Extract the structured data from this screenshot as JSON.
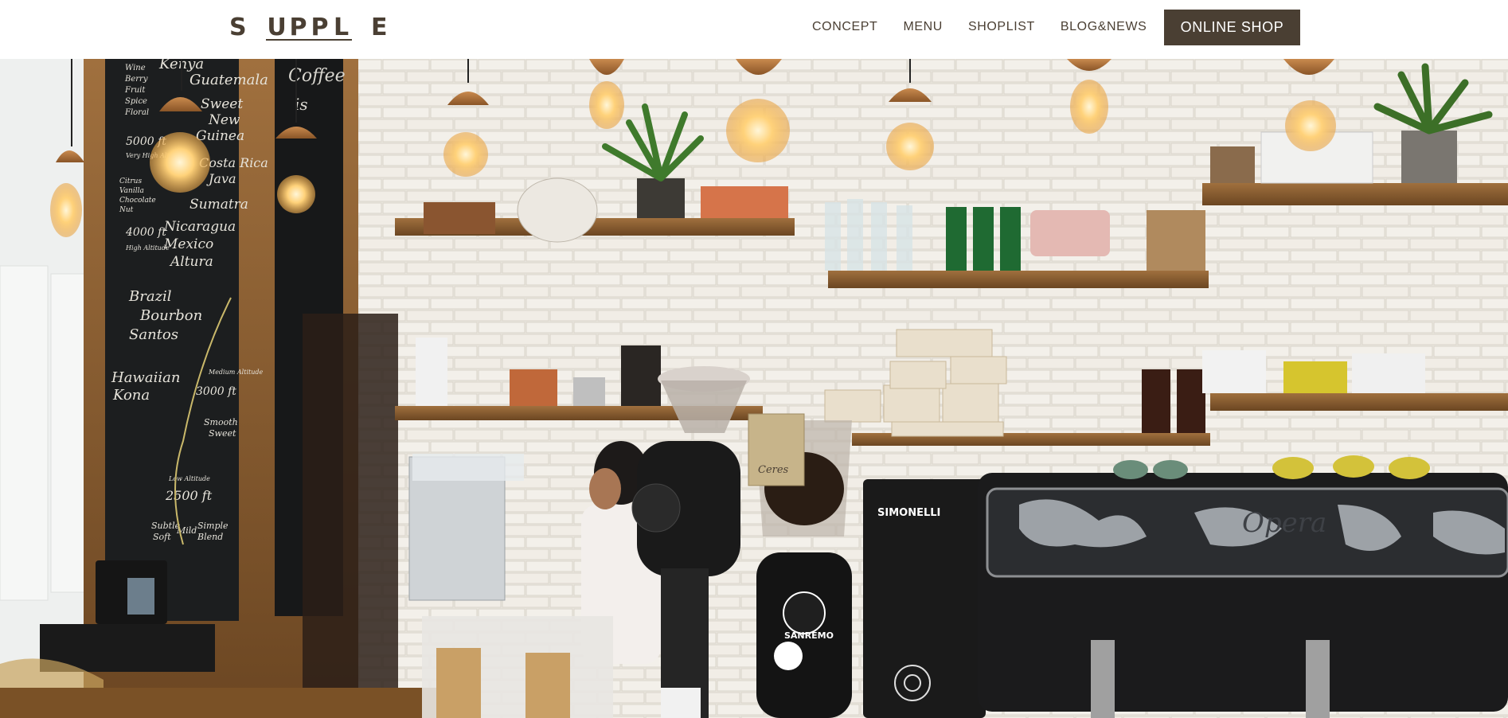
{
  "brand": {
    "first": "S",
    "middle": [
      "U",
      "P",
      "P",
      "L"
    ],
    "last": "E",
    "color": "#4a3f33"
  },
  "nav": {
    "links": [
      "CONCEPT",
      "MENU",
      "SHOPLIST",
      "BLOG&NEWS"
    ],
    "cta": "ONLINE SHOP"
  },
  "hero": {
    "menu_board": {
      "top": [
        "Kenya",
        "Guatemala"
      ],
      "left_col": [
        "Wine",
        "Berry",
        "Fruit",
        "Spice",
        "Floral"
      ],
      "lines": [
        "Sweet",
        "New",
        "Guinea",
        "Costa Rica",
        "Java",
        "Sumatra",
        "Nicaragua",
        "Mexico",
        "Altura",
        "Brazil",
        "Bourbon",
        "Santos",
        "Hawaiian",
        "Kona"
      ],
      "altitudes": [
        "5000 ft",
        "Very High Altitude",
        "4000 ft",
        "High Altitude",
        "3000 ft",
        "Medium Altitude",
        "2500 ft",
        "Low Altitude"
      ],
      "notes": [
        "Citrus",
        "Vanilla",
        "Chocolate",
        "Nut",
        "Smooth",
        "Sweet",
        "Subtle",
        "Soft",
        "Mild",
        "Simple",
        "Blend"
      ]
    },
    "machine_brand": "Opera",
    "grinder_brand": "SANREMO",
    "second_grinder_brand": "SIMONELLI",
    "bag_label": "Ceres"
  }
}
